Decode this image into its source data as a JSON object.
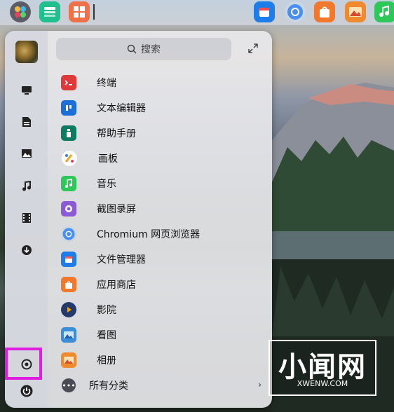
{
  "taskbar": {
    "icons": [
      {
        "name": "launcher-icon",
        "color": "#6a6a6a"
      },
      {
        "name": "multitask-view-icon",
        "color": "#1fbf8e"
      },
      {
        "name": "workspace-icon",
        "color": "#f0704a"
      },
      {
        "name": "file-manager-icon",
        "color": "#1e7de8"
      },
      {
        "name": "chromium-icon",
        "color": "#4a8ef0"
      },
      {
        "name": "app-store-icon",
        "color": "#f2782b"
      },
      {
        "name": "image-viewer-icon",
        "color": "#f08a2e"
      },
      {
        "name": "music-icon",
        "color": "#2ec75a"
      }
    ]
  },
  "sidebar": {
    "items": [
      {
        "name": "computer-icon"
      },
      {
        "name": "documents-icon"
      },
      {
        "name": "pictures-icon"
      },
      {
        "name": "music-icon"
      },
      {
        "name": "videos-icon"
      },
      {
        "name": "downloads-icon"
      },
      {
        "name": "settings-icon"
      },
      {
        "name": "power-icon"
      }
    ]
  },
  "search": {
    "placeholder": "搜索"
  },
  "apps": [
    {
      "label": "终端",
      "icon": "terminal-icon",
      "color": "#e0393a"
    },
    {
      "label": "文本编辑器",
      "icon": "text-editor-icon",
      "color": "#1d6fd8"
    },
    {
      "label": "帮助手册",
      "icon": "help-manual-icon",
      "color": "#0f7a62"
    },
    {
      "label": "画板",
      "icon": "draw-icon",
      "color": "#f4a21a"
    },
    {
      "label": "音乐",
      "icon": "music-icon",
      "color": "#2ec75a"
    },
    {
      "label": "截图录屏",
      "icon": "screenshot-icon",
      "color": "#8b5bd6"
    },
    {
      "label": "Chromium 网页浏览器",
      "icon": "chromium-icon",
      "color": "#4a8ef0"
    },
    {
      "label": "文件管理器",
      "icon": "file-manager-icon",
      "color": "#1e7de8"
    },
    {
      "label": "应用商店",
      "icon": "app-store-icon",
      "color": "#f2782b"
    },
    {
      "label": "影院",
      "icon": "movie-icon",
      "color": "#243a6b"
    },
    {
      "label": "看图",
      "icon": "image-viewer-icon",
      "color": "#3d8ed8"
    },
    {
      "label": "相册",
      "icon": "album-icon",
      "color": "#f08a2e"
    }
  ],
  "all_categories": {
    "label": "所有分类"
  },
  "watermark": {
    "title": "小闻网",
    "url": "XWENW.COM"
  }
}
